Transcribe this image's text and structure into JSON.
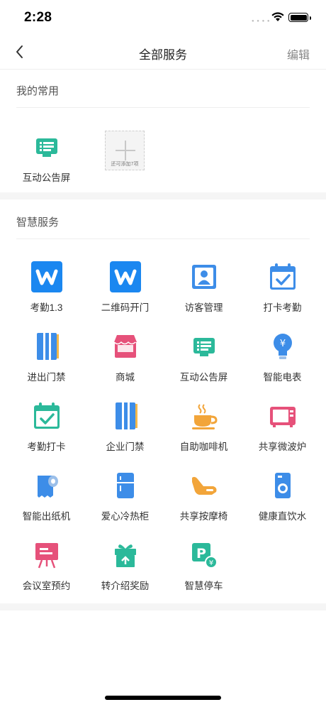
{
  "status": {
    "time": "2:28"
  },
  "nav": {
    "title": "全部服务",
    "edit": "编辑"
  },
  "favorites": {
    "title": "我的常用",
    "items": [
      {
        "label": "互动公告屏",
        "icon": "notice-screen-icon",
        "color": "#2bb99a"
      }
    ],
    "add_slot_text": "还可添加7项"
  },
  "smart": {
    "title": "智慧服务",
    "items": [
      {
        "label": "考勤1.3",
        "icon": "w-app-icon",
        "color": "#1b87f0"
      },
      {
        "label": "二维码开门",
        "icon": "w-app-icon",
        "color": "#1b87f0"
      },
      {
        "label": "访客管理",
        "icon": "visitor-icon",
        "color": "#3d8de8"
      },
      {
        "label": "打卡考勤",
        "icon": "calendar-check-icon",
        "color": "#3d8de8"
      },
      {
        "label": "进出门禁",
        "icon": "door-icon",
        "color": "#3d8de8"
      },
      {
        "label": "商城",
        "icon": "shop-icon",
        "color": "#e6517a"
      },
      {
        "label": "互动公告屏",
        "icon": "notice-screen-icon",
        "color": "#2bb99a"
      },
      {
        "label": "智能电表",
        "icon": "bulb-icon",
        "color": "#3d8de8"
      },
      {
        "label": "考勤打卡",
        "icon": "calendar-check-icon",
        "color": "#2bb99a"
      },
      {
        "label": "企业门禁",
        "icon": "door-icon",
        "color": "#3d8de8"
      },
      {
        "label": "自助咖啡机",
        "icon": "coffee-icon",
        "color": "#f2a53a"
      },
      {
        "label": "共享微波炉",
        "icon": "microwave-icon",
        "color": "#e6517a"
      },
      {
        "label": "智能出纸机",
        "icon": "paper-roll-icon",
        "color": "#3d8de8"
      },
      {
        "label": "爱心冷热柜",
        "icon": "fridge-icon",
        "color": "#3d8de8"
      },
      {
        "label": "共享按摩椅",
        "icon": "massage-chair-icon",
        "color": "#f2a53a"
      },
      {
        "label": "健康直饮水",
        "icon": "water-dispenser-icon",
        "color": "#3d8de8"
      },
      {
        "label": "会议室预约",
        "icon": "meeting-board-icon",
        "color": "#e6517a"
      },
      {
        "label": "转介绍奖励",
        "icon": "gift-icon",
        "color": "#2bb99a"
      },
      {
        "label": "智慧停车",
        "icon": "parking-icon",
        "color": "#2bb99a"
      }
    ]
  }
}
